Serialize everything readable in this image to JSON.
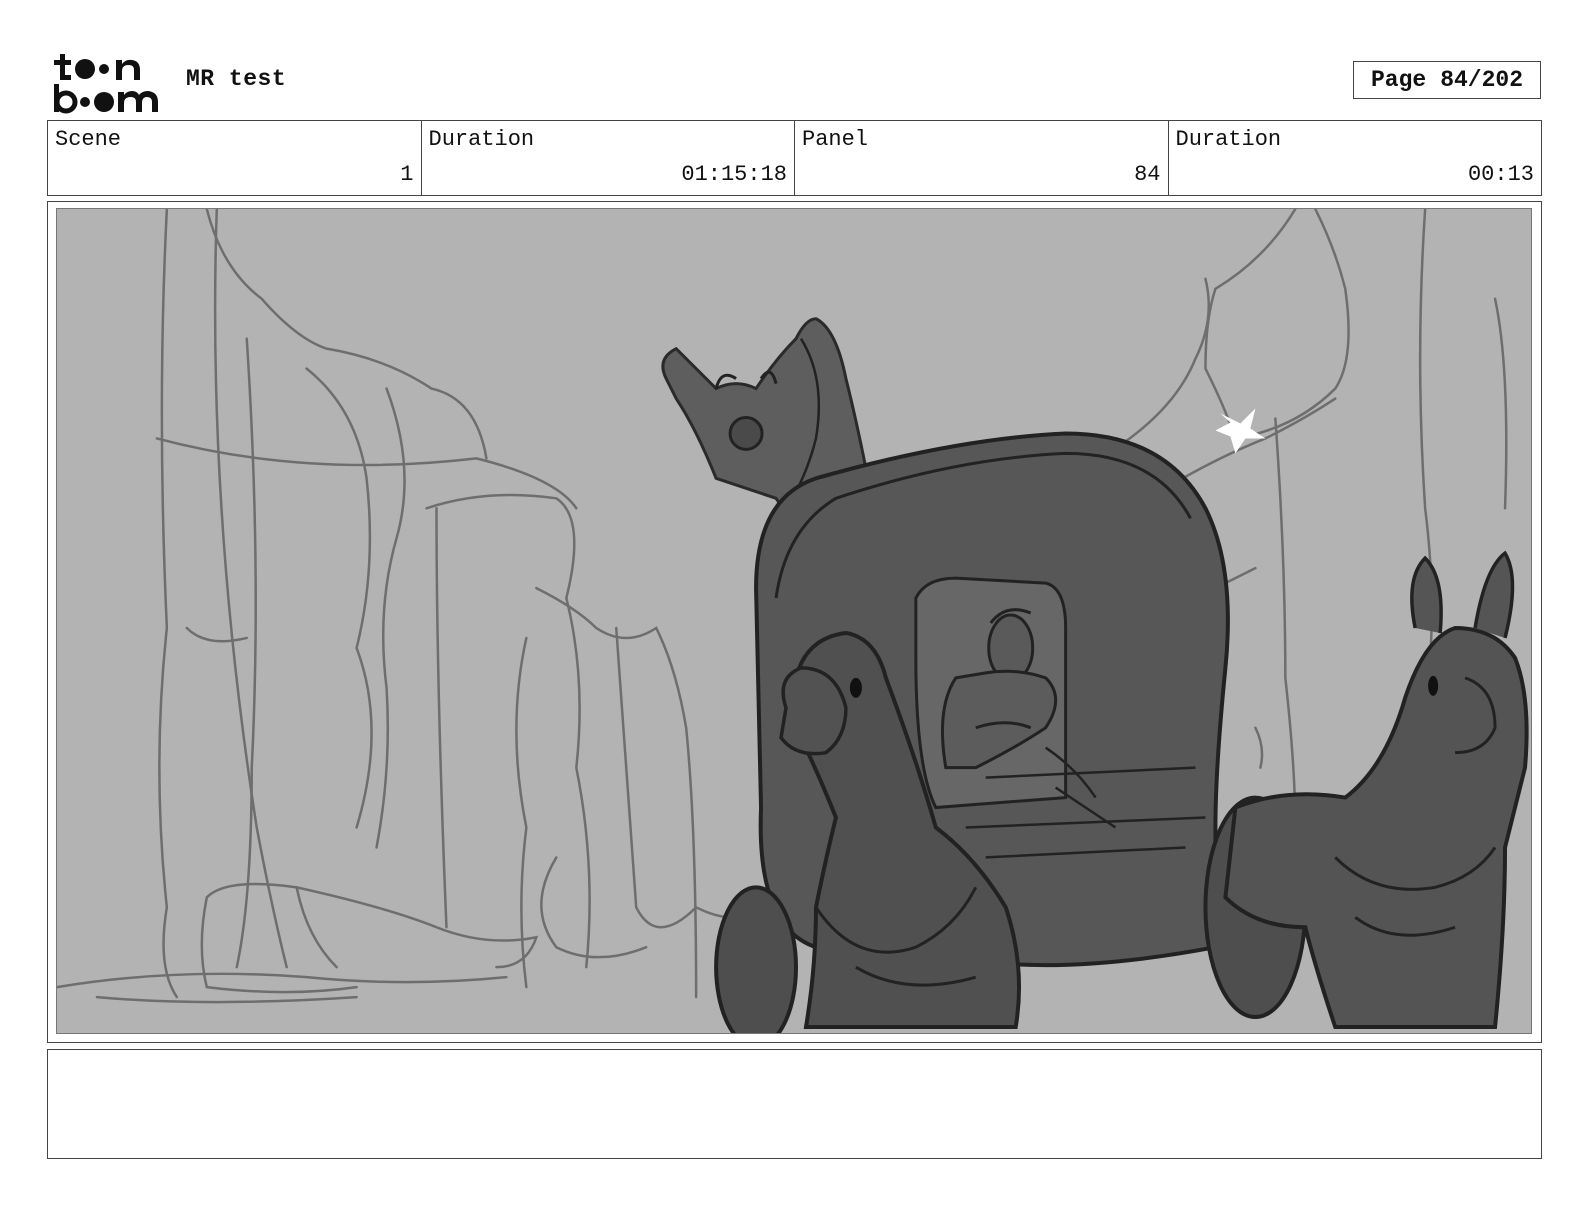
{
  "header": {
    "logo_text_top": "toon",
    "logo_text_bottom": "boom",
    "project_title": "MR test",
    "page_label": "Page",
    "page_value": "84/202"
  },
  "info": {
    "scene_label": "Scene",
    "scene_value": "1",
    "scene_duration_label": "Duration",
    "scene_duration_value": "01:15:18",
    "panel_label": "Panel",
    "panel_value": "84",
    "panel_duration_label": "Duration",
    "panel_duration_value": "00:13"
  },
  "notes": {
    "text": ""
  },
  "colors": {
    "panel_background": "#b3b3b3",
    "sketch_dark": "#5a5a5a",
    "sketch_line": "#2a2a2a",
    "rock_line": "#707070"
  }
}
